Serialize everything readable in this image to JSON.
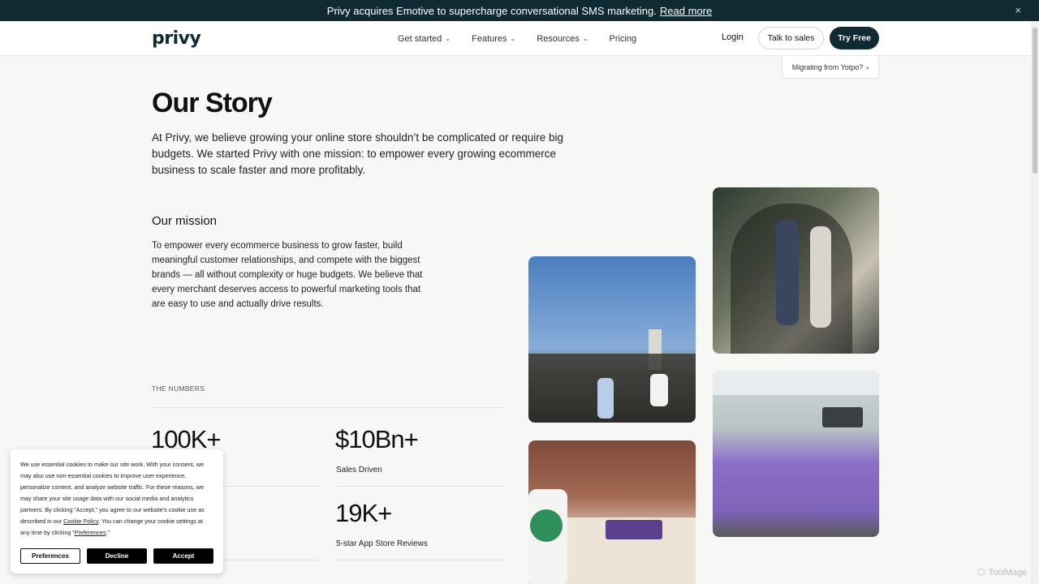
{
  "announcement": {
    "text": "Privy acquires Emotive to supercharge conversational SMS marketing.",
    "link": "Read more",
    "close_icon": "×"
  },
  "nav": {
    "logo": "privy",
    "menu": [
      {
        "label": "Get started",
        "has_dropdown": true
      },
      {
        "label": "Features",
        "has_dropdown": true
      },
      {
        "label": "Resources",
        "has_dropdown": true
      },
      {
        "label": "Pricing",
        "has_dropdown": false
      }
    ],
    "login": "Login",
    "talk_to_sales": "Talk to sales",
    "try_free": "Try Free",
    "migrating": "Migrating from Yotpo?"
  },
  "hero": {
    "title": "Our Story",
    "intro": "At Privy, we believe growing your online store shouldn’t be complicated or require big budgets. We started Privy with one mission: to empower every growing ecommerce business to scale faster and more profitably."
  },
  "mission": {
    "heading": "Our mission",
    "body": "To empower every ecommerce business to grow faster, build meaningful customer relationships, and compete with the biggest brands — all without complexity or huge budgets. We believe that every merchant deserves access to powerful marketing tools that are easy to use and actually drive results."
  },
  "numbers": {
    "label": "THE NUMBERS",
    "stats": [
      {
        "value": "100K+",
        "label": ""
      },
      {
        "value": "$10Bn+",
        "label": "Sales Driven"
      },
      {
        "value": "19K+",
        "label": "5-star App Store Reviews"
      }
    ]
  },
  "cookie_banner": {
    "text_1": "We use essential cookies to make our site work. With your consent, we may also use non-essential cookies to improve user experience, personalize content, and analyze website traffic. For these reasons, we may share your site usage data with our social media and analytics partners. By clicking “Accept,” you agree to our website's cookie use as described in our ",
    "policy_link": "Cookie Policy",
    "text_2": ". You can change your cookie settings at any time by clicking “",
    "preferences_link": "Preferences",
    "text_3": ".”",
    "buttons": {
      "preferences": "Preferences",
      "decline": "Decline",
      "accept": "Accept"
    }
  },
  "watermark": "ToolMage",
  "colors": {
    "brand_dark": "#0f2a33",
    "background": "#f7f7f6"
  }
}
